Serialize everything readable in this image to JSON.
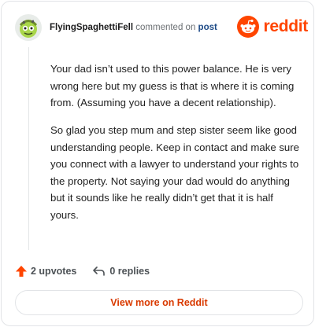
{
  "comment": {
    "author": "FlyingSpaghettiFell",
    "commented_on_text": "commented on",
    "post_link_text": "post",
    "paragraphs": [
      "Your dad isn’t used to this power balance. He is very wrong here but my guess is that is where it is coming from. (Assuming you have a decent relationship).",
      "So glad you step mum and step sister seem like good understanding people. Keep in contact and make sure you connect with a lawyer to understand your rights to the property. Not saying your dad would do anything but it sounds like he really didn’t get that it is half yours."
    ]
  },
  "brand": {
    "wordmark": "reddit",
    "color": "#ff4500"
  },
  "actions": {
    "upvotes_label": "2 upvotes",
    "replies_label": "0 replies",
    "upvote_icon": "upvote-arrow-icon",
    "reply_icon": "reply-arrow-icon"
  },
  "footer": {
    "view_more_label": "View more on Reddit"
  },
  "colors": {
    "accent": "#ff4500",
    "link": "#1d4a86",
    "cta_text": "#d93a00"
  }
}
